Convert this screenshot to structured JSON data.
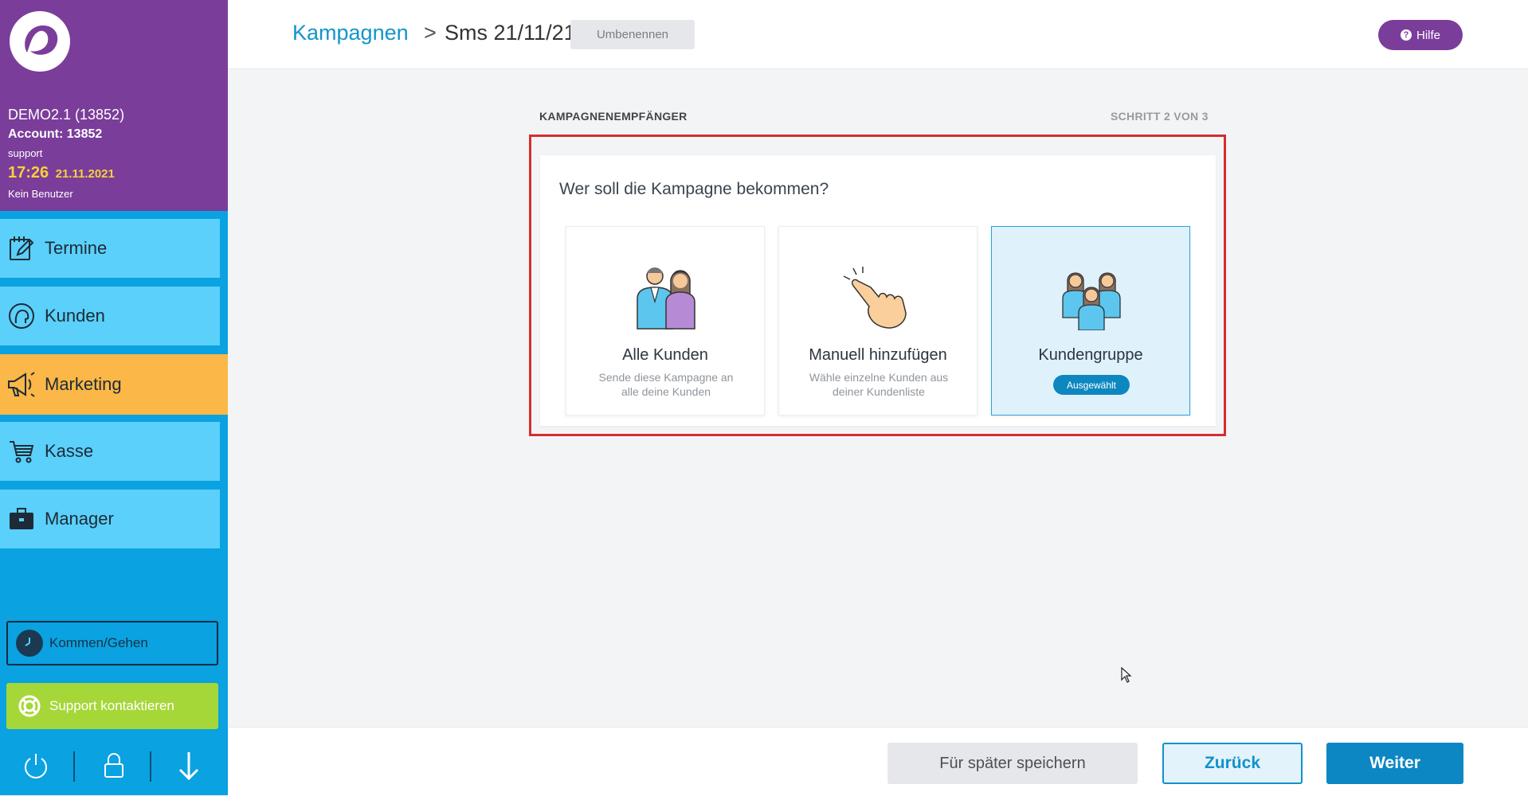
{
  "sidebar": {
    "account": {
      "name": "DEMO2.1 (13852)",
      "id_line": "Account: 13852",
      "user": "support",
      "time": "17:26",
      "date": "21.11.2021",
      "current_user": "Kein Benutzer"
    },
    "nav": [
      {
        "label": "Termine",
        "icon": "calendar-edit-icon"
      },
      {
        "label": "Kunden",
        "icon": "customer-head-icon"
      },
      {
        "label": "Marketing",
        "icon": "megaphone-icon",
        "active": true
      },
      {
        "label": "Kasse",
        "icon": "shopping-cart-icon"
      },
      {
        "label": "Manager",
        "icon": "briefcase-icon"
      }
    ],
    "kommen_gehen": "Kommen/Gehen",
    "support": "Support kontaktieren",
    "bottom_icons": [
      "power-icon",
      "lock-icon",
      "arrow-down-icon"
    ]
  },
  "header": {
    "breadcrumb_link": "Kampagnen",
    "breadcrumb_separator": ">",
    "breadcrumb_current": "Sms 21/11/21",
    "rename_button": "Umbenennen",
    "help_button": "Hilfe"
  },
  "main": {
    "section_title": "KAMPAGNENEMPFÄNGER",
    "step": "SCHRITT 2 VON 3",
    "question": "Wer soll die Kampagne bekommen?",
    "options": [
      {
        "title": "Alle Kunden",
        "description": "Sende diese Kampagne an alle deine Kunden",
        "icon": "people-couple-icon"
      },
      {
        "title": "Manuell hinzufügen",
        "description": "Wähle einzelne Kunden aus deiner Kundenliste",
        "icon": "pointing-hand-icon"
      },
      {
        "title": "Kundengruppe",
        "badge": "Ausgewählt",
        "selected": true,
        "icon": "customer-group-icon"
      }
    ]
  },
  "footer": {
    "save_later": "Für später speichern",
    "back": "Zurück",
    "next": "Weiter"
  },
  "colors": {
    "sidebar_purple": "#7b3d9a",
    "sidebar_blue": "#0aa2e0",
    "nav_item": "#5ad0fb",
    "nav_active": "#fbb747",
    "accent_blue": "#0c87c4",
    "support_green": "#a6d739",
    "highlight_red": "#d62d2d"
  }
}
